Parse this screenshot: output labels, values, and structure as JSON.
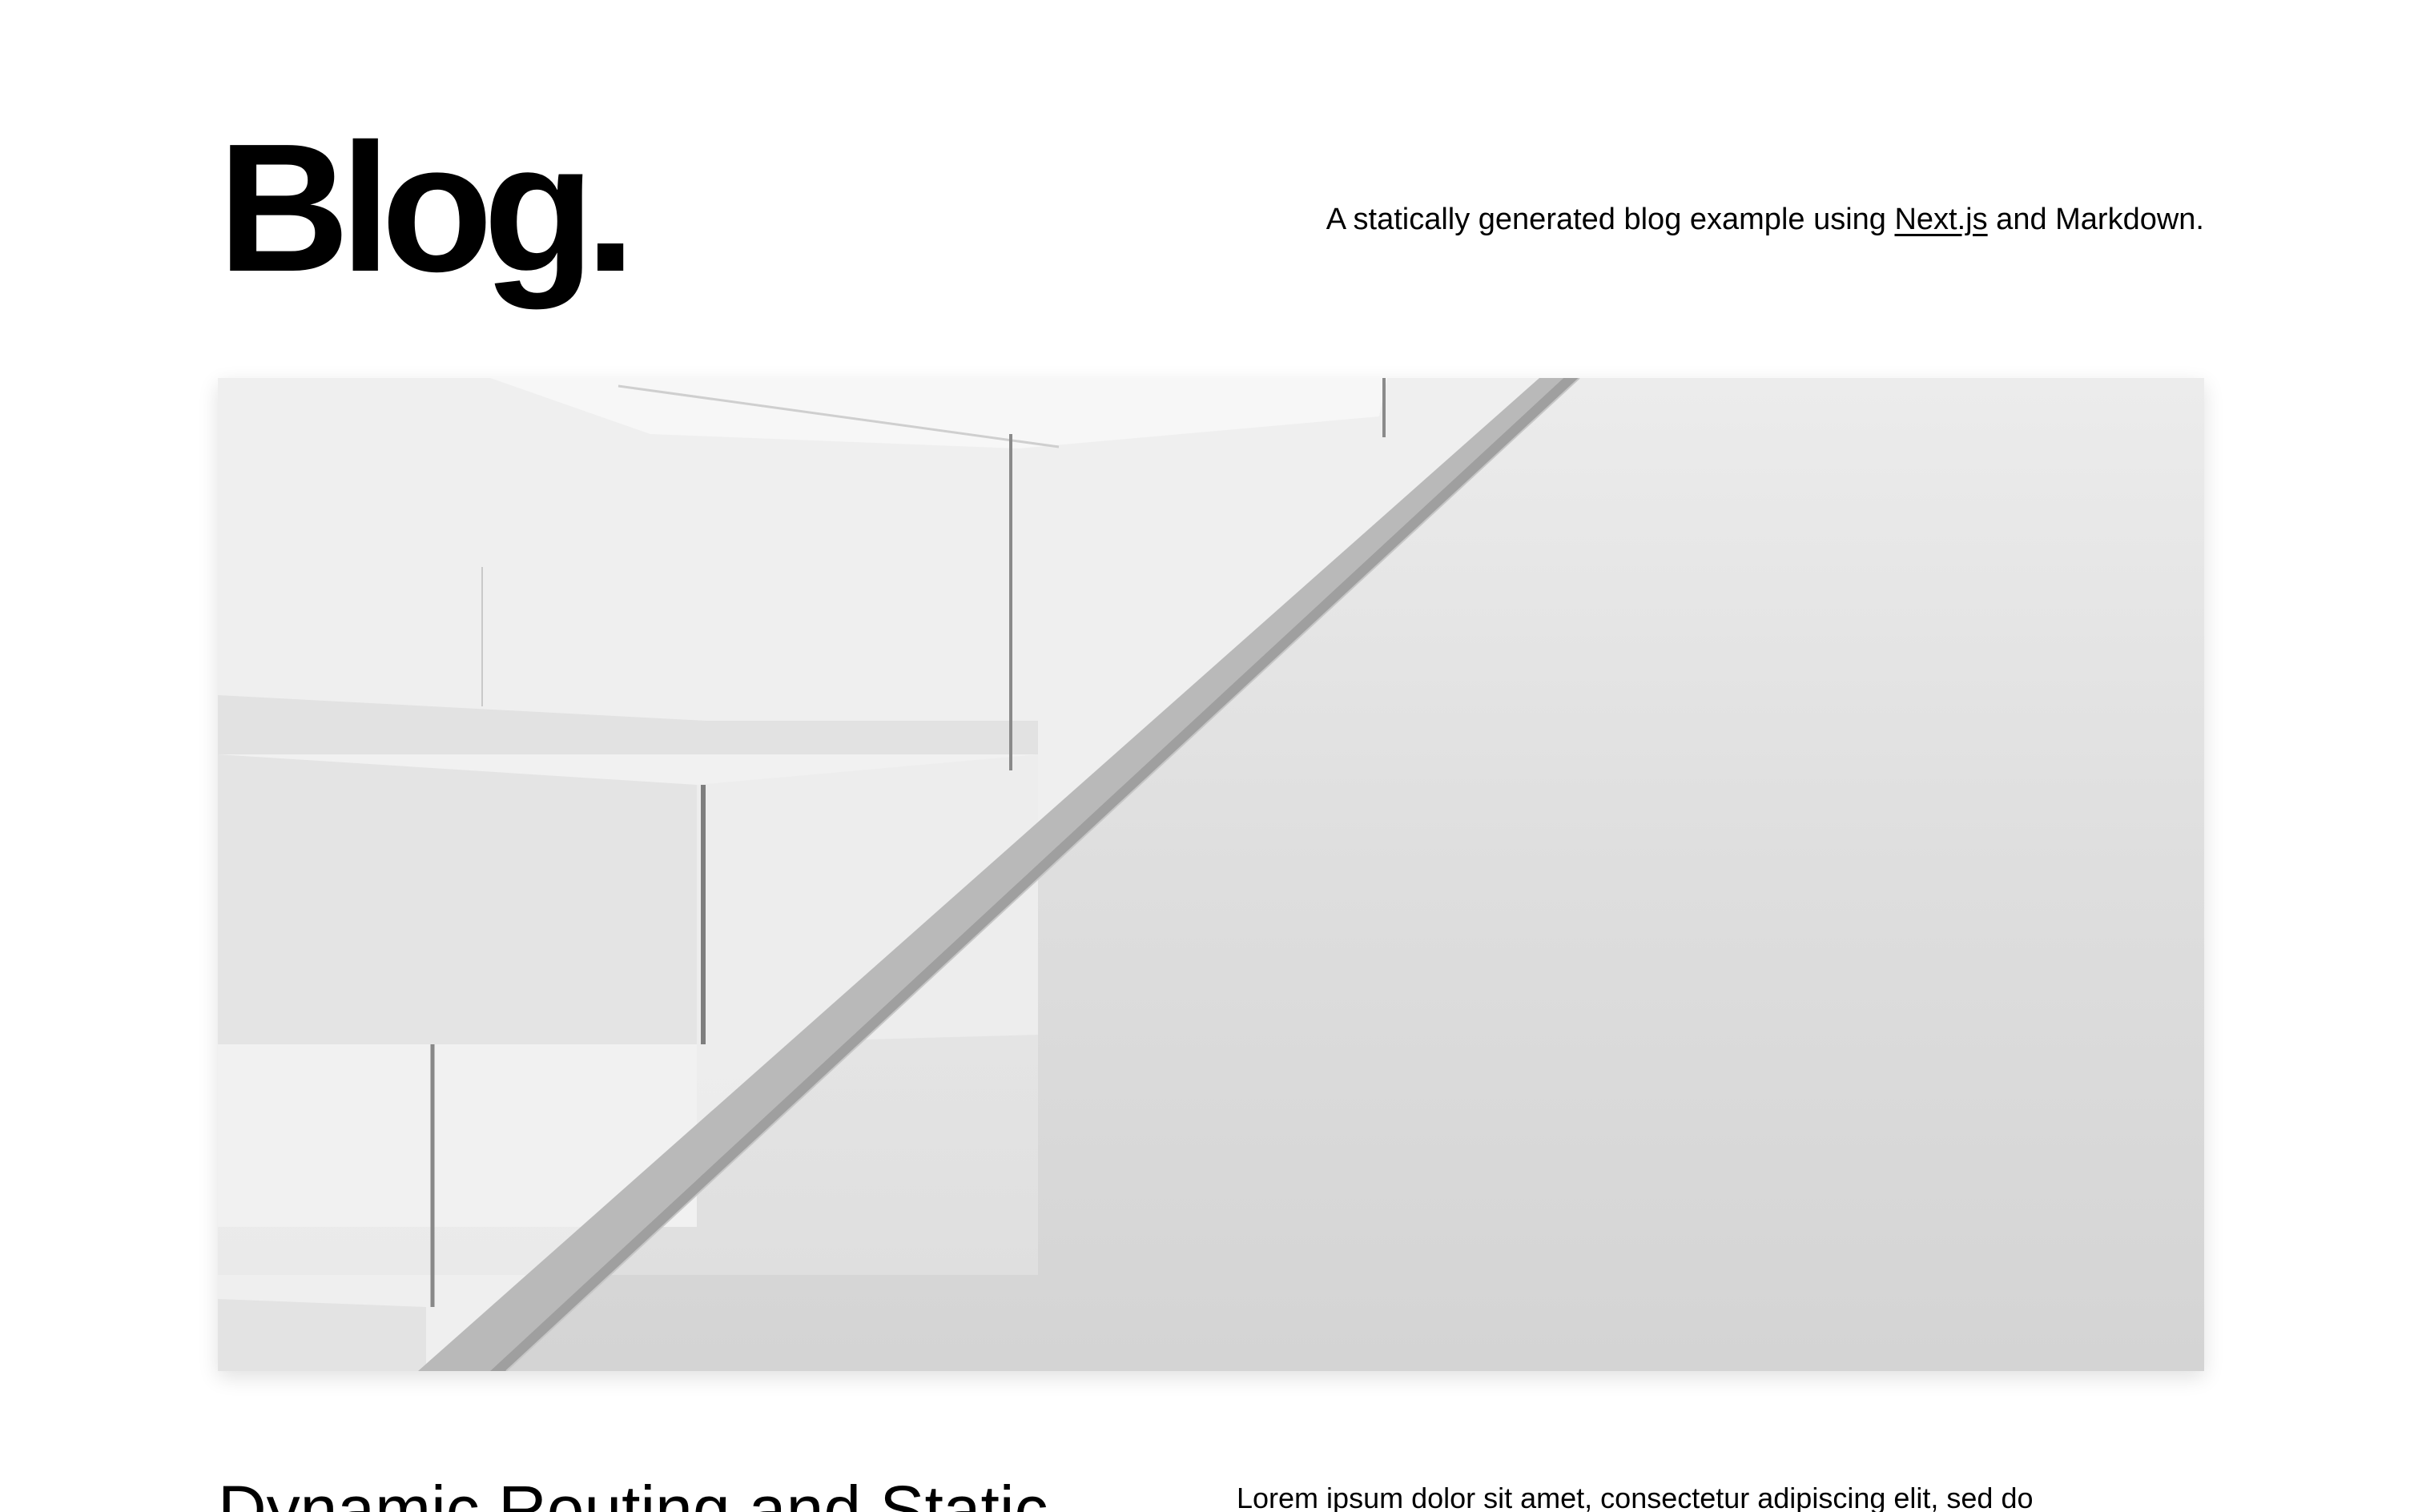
{
  "header": {
    "title": "Blog.",
    "tagline_prefix": "A statically generated blog example using ",
    "tagline_link": "Next.js",
    "tagline_suffix": " and Markdown."
  },
  "hero_post": {
    "cover_image_alt": "Cover image: white staircase",
    "title": "Dynamic Routing and Static",
    "excerpt": "Lorem ipsum dolor sit amet, consectetur adipiscing elit, sed do"
  }
}
